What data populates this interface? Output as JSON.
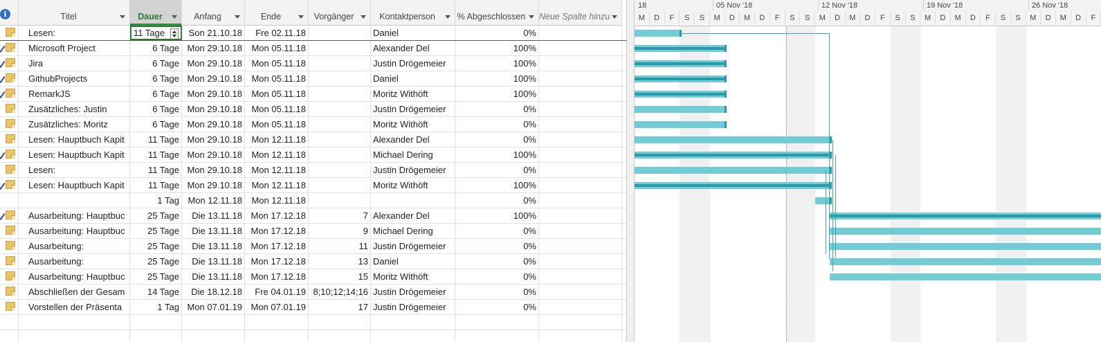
{
  "columns": {
    "info": "",
    "title": "Titel",
    "duration": "Dauer",
    "start": "Anfang",
    "end": "Ende",
    "predecessors": "Vorgänger",
    "contact": "Kontaktperson",
    "percent": "% Abgeschlossen",
    "new_column": "Neue Spalte hinzufügen"
  },
  "tasks": [
    {
      "title": "Lesen:",
      "duration": "11 Tage",
      "start": "Son 21.10.18",
      "end": "Fre 02.11.18",
      "pred": "",
      "contact": "Daniel",
      "percent": "0%",
      "done": false
    },
    {
      "title": "Microsoft Project",
      "duration": "6 Tage",
      "start": "Mon 29.10.18",
      "end": "Mon 05.11.18",
      "pred": "",
      "contact": "Alexander Del",
      "percent": "100%",
      "done": true
    },
    {
      "title": "Jira",
      "duration": "6 Tage",
      "start": "Mon 29.10.18",
      "end": "Mon 05.11.18",
      "pred": "",
      "contact": "Justin Drögemeier",
      "percent": "100%",
      "done": true
    },
    {
      "title": "GithubProjects",
      "duration": "6 Tage",
      "start": "Mon 29.10.18",
      "end": "Mon 05.11.18",
      "pred": "",
      "contact": "Daniel",
      "percent": "100%",
      "done": true
    },
    {
      "title": "RemarkJS",
      "duration": "6 Tage",
      "start": "Mon 29.10.18",
      "end": "Mon 05.11.18",
      "pred": "",
      "contact": "Moritz Withöft",
      "percent": "100%",
      "done": true
    },
    {
      "title": "Zusätzliches: Justin",
      "duration": "6 Tage",
      "start": "Mon 29.10.18",
      "end": "Mon 05.11.18",
      "pred": "",
      "contact": "Justin Drögemeier",
      "percent": "0%",
      "done": false
    },
    {
      "title": "Zusätzliches: Moritz",
      "duration": "6 Tage",
      "start": "Mon 29.10.18",
      "end": "Mon 05.11.18",
      "pred": "",
      "contact": "Moritz Withöft",
      "percent": "0%",
      "done": false
    },
    {
      "title": "Lesen: Hauptbuch Kapit",
      "duration": "11 Tage",
      "start": "Mon 29.10.18",
      "end": "Mon 12.11.18",
      "pred": "",
      "contact": "Alexander Del",
      "percent": "0%",
      "done": false
    },
    {
      "title": "Lesen: Hauptbuch Kapit",
      "duration": "11 Tage",
      "start": "Mon 29.10.18",
      "end": "Mon 12.11.18",
      "pred": "",
      "contact": "Michael Dering",
      "percent": "100%",
      "done": true
    },
    {
      "title": "Lesen:",
      "duration": "11 Tage",
      "start": "Mon 29.10.18",
      "end": "Mon 12.11.18",
      "pred": "",
      "contact": "Justin Drögemeier",
      "percent": "0%",
      "done": false
    },
    {
      "title": "Lesen:  Hauptbuch Kapit",
      "duration": "11 Tage",
      "start": "Mon 29.10.18",
      "end": "Mon 12.11.18",
      "pred": "",
      "contact": "Moritz Withöft",
      "percent": "100%",
      "done": true
    },
    {
      "title": "",
      "duration": "1 Tag",
      "start": "Mon 12.11.18",
      "end": "Mon 12.11.18",
      "pred": "",
      "contact": "",
      "percent": "0%",
      "done": false
    },
    {
      "title": "Ausarbeitung: Hauptbuc",
      "duration": "25 Tage",
      "start": "Die 13.11.18",
      "end": "Mon 17.12.18",
      "pred": "7",
      "contact": "Alexander Del",
      "percent": "100%",
      "done": true
    },
    {
      "title": "Ausarbeitung: Hauptbuc",
      "duration": "25 Tage",
      "start": "Die 13.11.18",
      "end": "Mon 17.12.18",
      "pred": "9",
      "contact": "Michael Dering",
      "percent": "0%",
      "done": false
    },
    {
      "title": "Ausarbeitung:",
      "duration": "25 Tage",
      "start": "Die 13.11.18",
      "end": "Mon 17.12.18",
      "pred": "11",
      "contact": "Justin Drögemeier",
      "percent": "0%",
      "done": false
    },
    {
      "title": "Ausarbeitung:",
      "duration": "25 Tage",
      "start": "Die 13.11.18",
      "end": "Mon 17.12.18",
      "pred": "13",
      "contact": "Daniel",
      "percent": "0%",
      "done": false
    },
    {
      "title": "Ausarbeitung: Hauptbuc",
      "duration": "25 Tage",
      "start": "Die 13.11.18",
      "end": "Mon 17.12.18",
      "pred": "15",
      "contact": "Moritz Withöft",
      "percent": "0%",
      "done": false
    },
    {
      "title": "Abschließen der Gesam",
      "duration": "14 Tage",
      "start": "Die 18.12.18",
      "end": "Fre 04.01.19",
      "pred": "8;10;12;14;16",
      "contact": "Justin Drögemeier",
      "percent": "0%",
      "done": false
    },
    {
      "title": "Vorstellen der Präsenta",
      "duration": "1 Tag",
      "start": "Mon 07.01.19",
      "end": "Mon 07.01.19",
      "pred": "17",
      "contact": "Justin Drögemeier",
      "percent": "0%",
      "done": false
    }
  ],
  "timeline": {
    "weeks": [
      "18",
      "05 Nov '18",
      "12 Nov '18",
      "19 Nov '18",
      "26 Nov '18"
    ],
    "days": [
      "M",
      "D",
      "F",
      "S",
      "S",
      "M",
      "D",
      "M",
      "D",
      "F",
      "S",
      "S",
      "M",
      "D",
      "M",
      "D",
      "F",
      "S",
      "S",
      "M",
      "D",
      "M",
      "D",
      "F",
      "S",
      "S",
      "M",
      "D",
      "M",
      "D",
      "F"
    ]
  },
  "colors": {
    "bar": "#72ccd6",
    "bar_progress": "#2a9aa8",
    "selected_header": "#2f8f3f"
  }
}
